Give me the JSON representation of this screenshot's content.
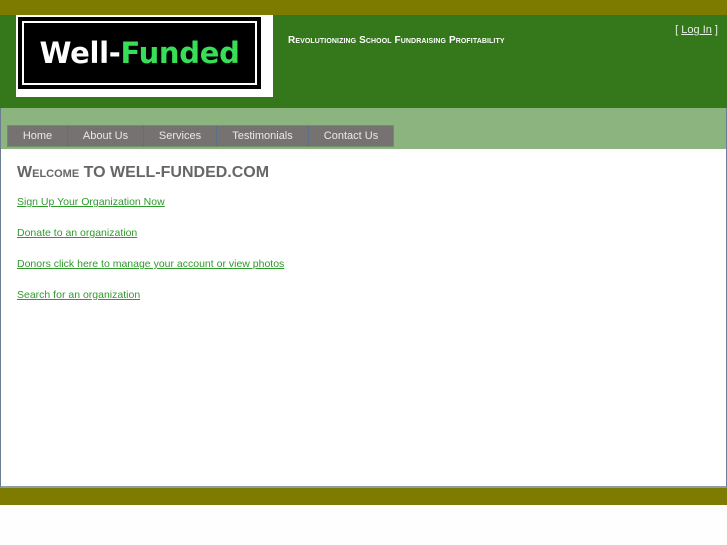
{
  "header": {
    "logo": {
      "part1": "Well-",
      "part2": "Funded"
    },
    "tagline": "Revolutionizing School Fundraising Profitability",
    "login": {
      "open": "[ ",
      "label": "Log In",
      "close": " ]"
    }
  },
  "nav": {
    "items": [
      {
        "label": "Home"
      },
      {
        "label": "About Us"
      },
      {
        "label": "Services"
      },
      {
        "label": "Testimonials"
      },
      {
        "label": "Contact Us"
      }
    ]
  },
  "main": {
    "heading": "Welcome TO WELL-FUNDED.COM",
    "links": [
      {
        "label": "Sign Up Your Organization Now"
      },
      {
        "label": "Donate to an organization"
      },
      {
        "label": "Donors click here to manage your account or view photos"
      },
      {
        "label": "Search for an organization"
      }
    ]
  },
  "colors": {
    "top_bar": "#7d7b00",
    "header_green": "#35781c",
    "nav_band": "#8bb47e",
    "nav_button": "#757271",
    "link_green": "#2f9a2c",
    "logo_accent": "#37df57"
  }
}
